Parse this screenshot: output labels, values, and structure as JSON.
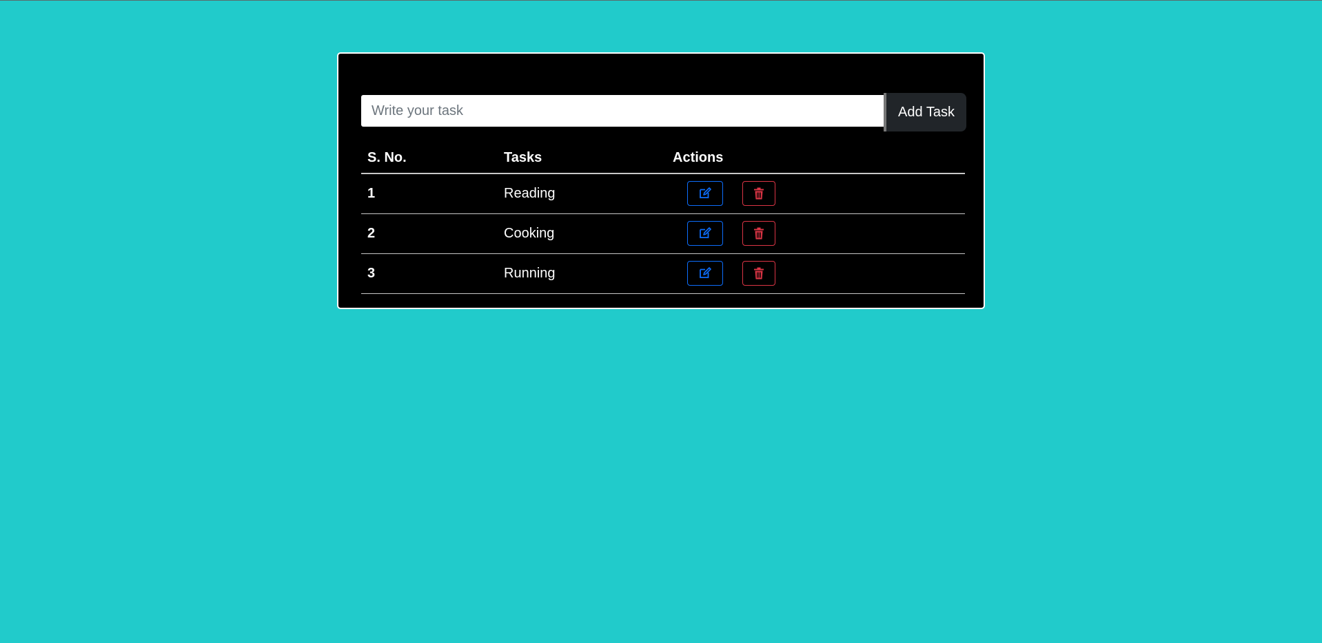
{
  "colors": {
    "page_background": "#21cbcb",
    "card_background": "#000000",
    "edit_accent": "#0d6efd",
    "delete_accent": "#dc3545",
    "add_button": "#212529"
  },
  "task_input": {
    "placeholder": "Write your task",
    "value": ""
  },
  "add_button": {
    "label": "Add Task"
  },
  "table": {
    "headers": {
      "sno": "S. No.",
      "tasks": "Tasks",
      "actions": "Actions"
    },
    "rows": [
      {
        "sno": "1",
        "task": "Reading",
        "edit_icon": "edit-icon",
        "delete_icon": "trash-icon"
      },
      {
        "sno": "2",
        "task": "Cooking",
        "edit_icon": "edit-icon",
        "delete_icon": "trash-icon"
      },
      {
        "sno": "3",
        "task": "Running",
        "edit_icon": "edit-icon",
        "delete_icon": "trash-icon"
      }
    ]
  }
}
